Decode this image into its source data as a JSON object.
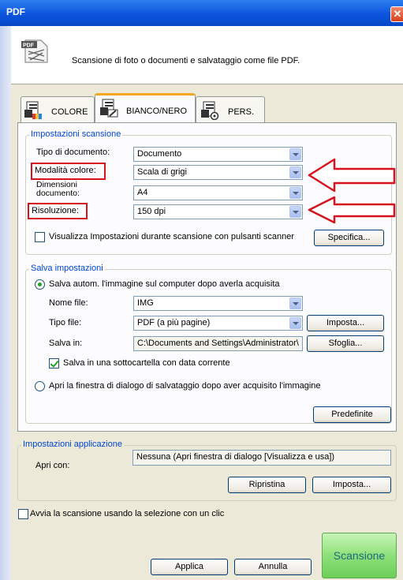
{
  "window": {
    "title": "PDF",
    "close_glyph": "✕"
  },
  "header": {
    "icon": "pdf-document-icon",
    "icon_text": "PDF",
    "description": "Scansione di foto o documenti e salvataggio come file PDF."
  },
  "tabs": [
    {
      "label": "COLORE",
      "icon": "color-document-icon",
      "active": false
    },
    {
      "label": "BIANCO/NERO",
      "icon": "blackwhite-document-icon",
      "active": true
    },
    {
      "label": "PERS.",
      "icon": "custom-document-icon",
      "active": false
    }
  ],
  "scan_settings": {
    "legend": "Impostazioni scansione",
    "document_type": {
      "label": "Tipo di documento:",
      "value": "Documento"
    },
    "color_mode": {
      "label": "Modalità colore:",
      "value": "Scala di grigi"
    },
    "document_size": {
      "label_line1": "Dimensioni",
      "label_line2": "documento:",
      "value": "A4"
    },
    "resolution": {
      "label": "Risoluzione:",
      "value": "150 dpi"
    },
    "show_settings": {
      "label": "Visualizza Impostazioni durante scansione con pulsanti scanner",
      "checked": false
    },
    "specify_button": "Specifica..."
  },
  "save_settings": {
    "legend": "Salva impostazioni",
    "auto_save": {
      "label": "Salva autom. l'immagine sul computer dopo averla acquisita",
      "checked": true
    },
    "file_name": {
      "label": "Nome file:",
      "value": "IMG"
    },
    "file_type": {
      "label": "Tipo file:",
      "value": "PDF (a più pagine)"
    },
    "settings_button": "Imposta...",
    "save_in": {
      "label": "Salva in:",
      "value": "C:\\Documents and Settings\\Administrator\\"
    },
    "browse_button": "Sfoglia...",
    "subfolder": {
      "label": "Salva in una sottocartella con data corrente",
      "checked": true
    },
    "open_dialog": {
      "label": "Apri la finestra di dialogo di salvataggio dopo aver acquisito l'immagine",
      "checked": false
    },
    "defaults_button": "Predefinite"
  },
  "app_settings": {
    "legend": "Impostazioni applicazione",
    "open_with": {
      "label": "Apri con:",
      "value": "Nessuna (Apri finestra di dialogo [Visualizza e usa])"
    },
    "reset_button": "Ripristina",
    "settings_button": "Imposta..."
  },
  "one_click": {
    "label": "Avvia la scansione usando la selezione con un clic",
    "checked": false
  },
  "footer": {
    "apply_button": "Applica",
    "cancel_button": "Annulla",
    "scan_button": "Scansione"
  },
  "annotation": {
    "highlight_color": "#d8121d",
    "arrow_color": "#d8121d"
  },
  "colors": {
    "titlebar": "#0a54dc",
    "dialog_background": "#ece9d8",
    "scan_button": "#8ee07a",
    "group_legend": "#0046d5"
  }
}
